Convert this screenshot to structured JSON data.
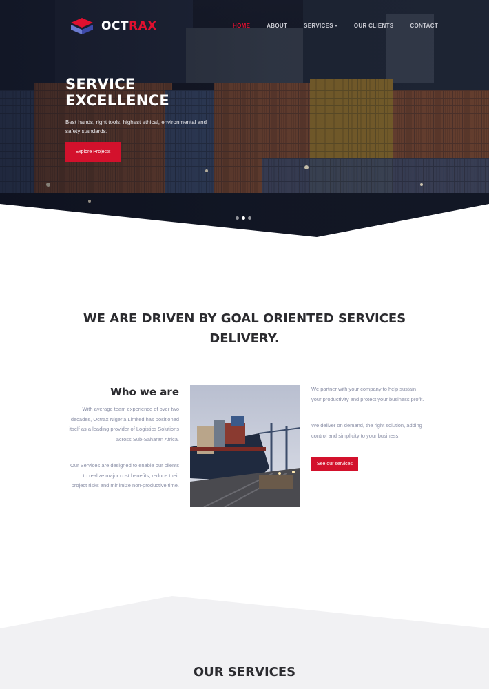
{
  "brand": {
    "name_part1": "OCT",
    "name_part2": "RAX",
    "accent": "#e0102f"
  },
  "nav": {
    "items": [
      {
        "label": "HOME",
        "active": true
      },
      {
        "label": "ABOUT"
      },
      {
        "label": "SERVICES"
      },
      {
        "label": "OUR CLIENTS"
      },
      {
        "label": "CONTACT"
      }
    ]
  },
  "hero": {
    "title_line1": "SERVICE",
    "title_line2": "EXCELLENCE",
    "text": "Best hands, right tools, highest ethical, environmental and safety standards.",
    "button": "Explore Projects",
    "slides": 3,
    "active_slide": 2
  },
  "about": {
    "heading": "WE ARE DRIVEN BY GOAL ORIENTED SERVICES DELIVERY.",
    "who_title": "Who we are",
    "who_p1": "With average team experience of over two decades, Octrax Nigeria Limited has positioned itself as a leading provider of Logistics Solutions across Sub-Saharan Africa.",
    "who_p2": "Our Services are designed to enable our clients to realize major cost benefits, reduce their project risks and minimize non-productive time.",
    "right_p1": "We partner with your company to help sustain your productivity and protect your business profit.",
    "right_p2": "We deliver on demand, the right solution, adding control and simplicity to your business.",
    "button": "See our services"
  },
  "services": {
    "heading": "OUR SERVICES"
  }
}
